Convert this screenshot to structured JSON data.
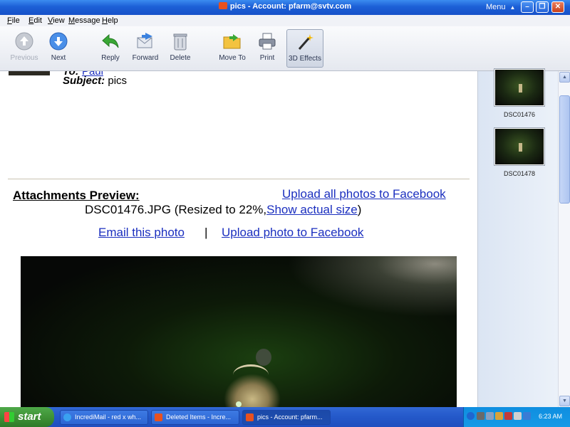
{
  "window": {
    "title": "pics - Account: pfarm@svtv.com",
    "menu_label": "Menu",
    "menu_arrow": "▲",
    "controls": {
      "minimize": "–",
      "maximize": "❐",
      "close": "✕"
    }
  },
  "menubar": [
    "File",
    "Edit",
    "View",
    "Message",
    "Help"
  ],
  "toolbar": {
    "previous": "Previous",
    "next": "Next",
    "reply": "Reply",
    "forward": "Forward",
    "delete": "Delete",
    "move_to": "Move To",
    "print": "Print",
    "effects": "3D Effects"
  },
  "message": {
    "to_label": "To:",
    "to_value": "Paul",
    "subject_label": "Subject:",
    "subject_value": "pics"
  },
  "attachments": {
    "title": "Attachments Preview:",
    "upload_all": "Upload all photos to Facebook",
    "file_name": "DSC01476.JPG",
    "resize_note": "(Resized to 22%,",
    "show_actual": "Show actual size",
    "close_paren": ")",
    "email_photo": "Email this photo",
    "separator": "|",
    "upload_photo": "Upload photo to Facebook"
  },
  "sidebar": {
    "thumbnails": [
      {
        "label": "DSC01476"
      },
      {
        "label": "DSC01478"
      }
    ]
  },
  "taskbar": {
    "start": "start",
    "tasks": [
      {
        "label": "IncrediMail - red x wh..."
      },
      {
        "label": "Deleted Items - Incre..."
      },
      {
        "label": "pics - Account: pfarm..."
      }
    ],
    "clock": "6:23 AM"
  }
}
